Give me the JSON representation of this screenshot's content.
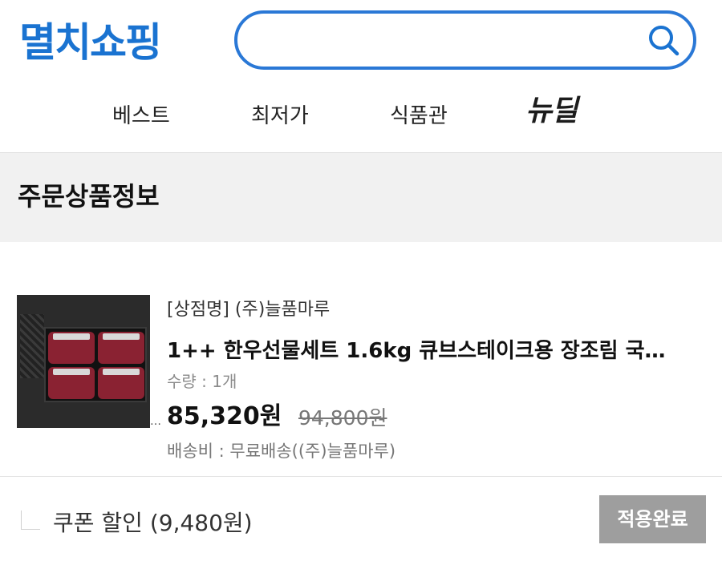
{
  "header": {
    "logo_text": "멸치쇼핑",
    "search": {
      "value": "",
      "placeholder": ""
    }
  },
  "nav": {
    "items": [
      {
        "label": "베스트"
      },
      {
        "label": "최저가"
      },
      {
        "label": "식품관"
      },
      {
        "label": "뉴딜"
      }
    ]
  },
  "section": {
    "title": "주문상품정보"
  },
  "product": {
    "shop_name": "[상점명] (주)늘품마루",
    "name": "1++ 한우선물세트 1.6kg 큐브스테이크용 장조림 국…",
    "quantity": "수량 : 1개",
    "price": "85,320원",
    "original_price": "94,800원",
    "shipping": "배송비 : 무료배송((주)늘품마루)",
    "thumb_overflow": "…"
  },
  "coupon": {
    "label": "쿠폰 할인 (9,480원)",
    "button_label": "적용완료",
    "checked": false
  },
  "colors": {
    "brand_blue": "#1a73d1",
    "search_border": "#2a78d6",
    "section_bg": "#f1f1f1",
    "button_gray": "#9e9e9e"
  }
}
